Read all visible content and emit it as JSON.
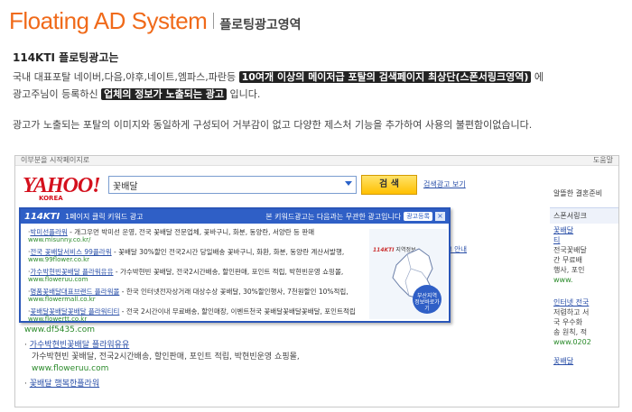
{
  "header": {
    "title": "Floating AD System",
    "subtitle": "플로팅광고영역"
  },
  "intro": {
    "heading": "114KTI 플로팅광고는",
    "p1_before": "국내 대표포탈 네이버,다음,야후,네이트,엠파스,파란등 ",
    "p1_highlight": "10여개 이상의 메이저급 포탈의 검색페이지 최상단(스폰서링크영역)",
    "p1_after": " 에",
    "p2_before": "광고주님이 등록하신 ",
    "p2_highlight": "업체의 정보가 노출되는 광고",
    "p2_after": " 입니다.",
    "p3": "광고가 노출되는 포탈의 이미지와 동일하게 구성되어 거부감이 없고 다양한 제스처 기능을 추가하여 사용의 불편함이없습니다."
  },
  "screenshot": {
    "topstrip_left": "이부분을 시작페이지로",
    "topstrip_right": "도움말",
    "logo_word": "YAHOO!",
    "logo_sub": "KOREA",
    "search_value": "꽃배달",
    "search_button": "검 색",
    "ads_link": "검색광고 보기",
    "right_link": "알뜰한 결혼준비",
    "popup": {
      "logo": "114KTI",
      "head_text": "1페이지 클릭 키워드 광고",
      "head_note": "본 키워드광고는 다음과는 무관한 광고입니다",
      "head_button": "광고등록",
      "close": "×",
      "items": [
        {
          "title": "박미선플라워",
          "desc": " - 개그우먼 박미선 운영, 전국 꽃배달 전문업체, 꽃바구니, 화분, 동양란, 서양란 등 판매",
          "url": "www.misunny.co.kr/"
        },
        {
          "title": "전국 꽃배달서비스 99플라워",
          "desc": " - 꽃배달 30%할인 전국2시간 당일배송 꽃바구니, 화환, 화분, 동양란 계산서발행,",
          "url": "www.99flower.co.kr"
        },
        {
          "title": "가수박현빈꽃배달 플라워유유",
          "desc": " - 가수박현빈 꽃배달, 전국2시간배송, 할인판매, 포인트 적립, 박현빈운영 쇼핑몰,",
          "url": "www.floweruu.com"
        },
        {
          "title": "명품꽃배달대표브랜드 플라워몰",
          "desc": " - 한국 인터넷전자상거래 대상수상 꽃배달, 30%할인행사, 7천원할인 10%적립,",
          "url": "www.flowermall.co.kr"
        },
        {
          "title": "꽃배달꽃배달꽃배달 플라워티티",
          "desc": " - 전국 2시간이내 무료배송, 할인매장, 이벤트천국 꽃배달꽃배달꽃배달, 포인트적립",
          "url": "www.flowertt.co.kr"
        }
      ],
      "map_brand": "114KTI",
      "map_brand_sub": "지역정보",
      "map_badge_1": "부산지역",
      "map_badge_2": "정보바로가기"
    },
    "results": [
      {
        "url_only": "www.df5435.com"
      },
      {
        "title": "가수박현빈꽃배달 플라워유유",
        "desc": "가수박현빈 꽃배달, 전국2시간배송, 할인판매, 포인트 적립, 박현빈운영 쇼핑몰,",
        "url": "www.floweruu.com"
      },
      {
        "title": "꽃배달 행복한플라워"
      }
    ],
    "partial_link": "리크 안내",
    "right_col": {
      "head": "스폰서링크",
      "t1": "꽃배달",
      "t1b": "티",
      "d1": "전국꽃배달",
      "d1b": "간 무료배",
      "d1c": "행사, 포인",
      "u1": "www.",
      "t2": "인터넷 전국",
      "d2": "저렴하고 서",
      "d2b": "국 우수화",
      "d2c": "송 원칙, 적",
      "u2": "www.0202",
      "t3": "꽃배달"
    }
  }
}
